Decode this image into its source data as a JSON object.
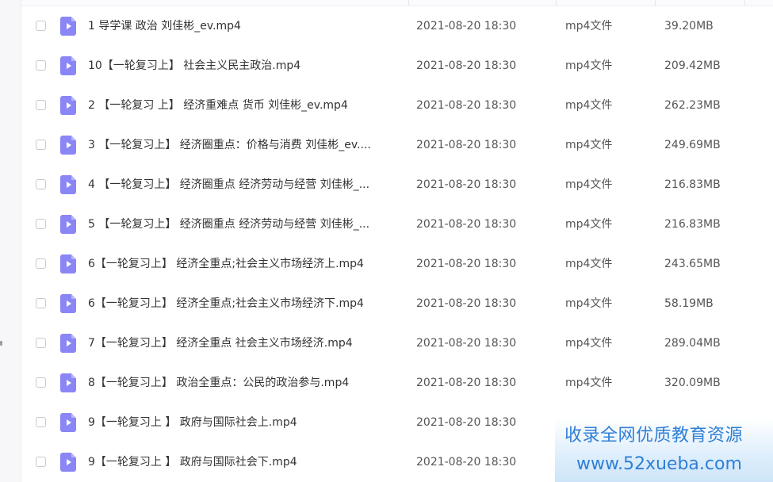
{
  "icons": {
    "file": "video-file-icon",
    "play": "play-icon",
    "checkbox": "checkbox-icon"
  },
  "colors": {
    "file_icon": "#8b86f5",
    "watermark_text": "#2f7fd6"
  },
  "files": [
    {
      "name": "1  导学课   政治 刘佳彬_ev.mp4",
      "date": "2021-08-20 18:30",
      "type": "mp4文件",
      "size": "39.20MB"
    },
    {
      "name": "10【一轮复习上】  社会主义民主政治.mp4",
      "date": "2021-08-20 18:30",
      "type": "mp4文件",
      "size": "209.42MB"
    },
    {
      "name": "2 【一轮复习 上】 经济重难点  货币   刘佳彬_ev.mp4",
      "date": "2021-08-20 18:30",
      "type": "mp4文件",
      "size": "262.23MB"
    },
    {
      "name": "3 【一轮复习上】 经济圈重点：价格与消费  刘佳彬_ev....",
      "date": "2021-08-20 18:30",
      "type": "mp4文件",
      "size": "249.69MB"
    },
    {
      "name": "4 【一轮复习上】  经济圈重点 经济劳动与经营   刘佳彬_...",
      "date": "2021-08-20 18:30",
      "type": "mp4文件",
      "size": "216.83MB"
    },
    {
      "name": "5 【一轮复习上】  经济圈重点 经济劳动与经营   刘佳彬_...",
      "date": "2021-08-20 18:30",
      "type": "mp4文件",
      "size": "216.83MB"
    },
    {
      "name": "6【一轮复习上】 经济全重点;社会主义市场经济上.mp4",
      "date": "2021-08-20 18:30",
      "type": "mp4文件",
      "size": "243.65MB"
    },
    {
      "name": "6【一轮复习上】 经济全重点;社会主义市场经济下.mp4",
      "date": "2021-08-20 18:30",
      "type": "mp4文件",
      "size": "58.19MB"
    },
    {
      "name": "7【一轮复习上】 经济全重点  社会主义市场经济.mp4",
      "date": "2021-08-20 18:30",
      "type": "mp4文件",
      "size": "289.04MB"
    },
    {
      "name": "8【一轮复习上】 政治全重点：公民的政治参与.mp4",
      "date": "2021-08-20 18:30",
      "type": "mp4文件",
      "size": "320.09MB"
    },
    {
      "name": "9【一轮复习上 】  政府与国际社会上.mp4",
      "date": "2021-08-20 18:30",
      "type": "",
      "size": ""
    },
    {
      "name": "9【一轮复习上 】  政府与国际社会下.mp4",
      "date": "2021-08-20 18:30",
      "type": "",
      "size": ""
    }
  ],
  "watermark": {
    "line1": "收录全网优质教育资源",
    "line2": "www.52xueba.com"
  }
}
